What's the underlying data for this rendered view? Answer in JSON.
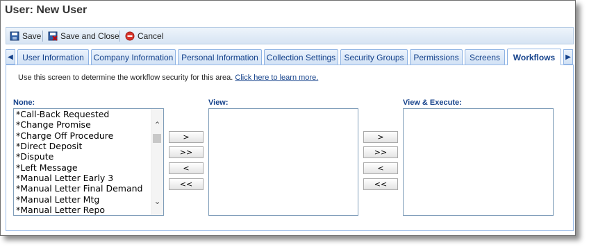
{
  "window": {
    "title": "User: New User"
  },
  "toolbar": {
    "save": "Save",
    "save_close": "Save and Close",
    "cancel": "Cancel"
  },
  "tabs": [
    {
      "label": "User Information"
    },
    {
      "label": "Company Information"
    },
    {
      "label": "Personal Information"
    },
    {
      "label": "Collection Settings"
    },
    {
      "label": "Security Groups"
    },
    {
      "label": "Permissions"
    },
    {
      "label": "Screens"
    },
    {
      "label": "Workflows",
      "active": true
    }
  ],
  "instructions": {
    "text": "Use this screen to determine the workflow security for this area.",
    "link": "Click here to learn more."
  },
  "lists": {
    "none": {
      "label": "None:",
      "items": [
        "*Call-Back Requested",
        "*Change Promise",
        "*Charge Off Procedure",
        "*Direct Deposit",
        "*Dispute",
        "*Left Message",
        "*Manual Letter Early 3",
        "*Manual Letter Final Demand",
        "*Manual Letter Mtg",
        "*Manual Letter Repo"
      ]
    },
    "view": {
      "label": "View:",
      "items": []
    },
    "view_execute": {
      "label": "View & Execute:",
      "items": []
    }
  },
  "move_buttons": {
    "add": ">",
    "add_all": ">>",
    "remove": "<",
    "remove_all": "<<"
  },
  "colors": {
    "accent": "#15428b",
    "border": "#99bbe8"
  }
}
